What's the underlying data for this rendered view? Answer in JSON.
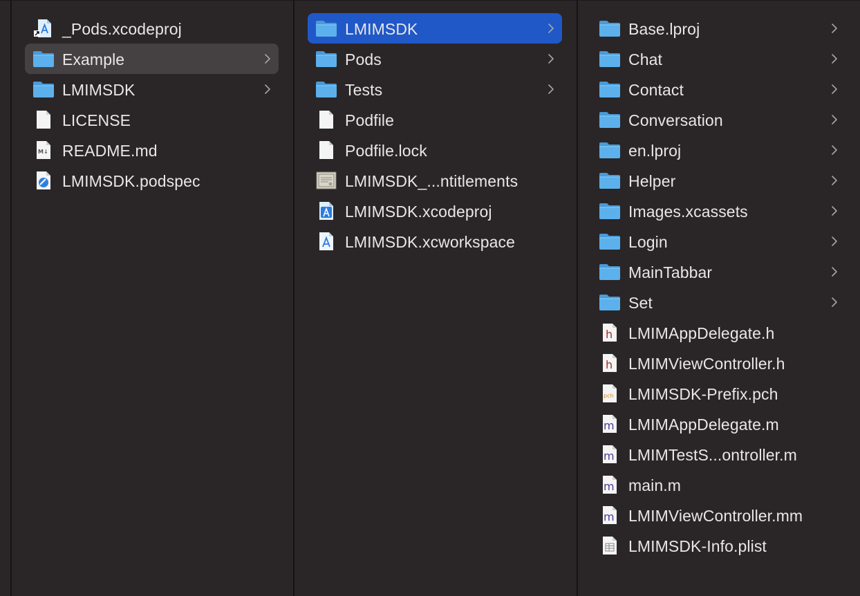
{
  "columns": [
    {
      "name": "column-1",
      "items": [
        {
          "label": "_Pods.xcodeproj",
          "type": "xcodeproj-alias",
          "chevron": false,
          "state": ""
        },
        {
          "label": "Example",
          "type": "folder",
          "chevron": true,
          "state": "inactive"
        },
        {
          "label": "LMIMSDK",
          "type": "folder",
          "chevron": true,
          "state": ""
        },
        {
          "label": "LICENSE",
          "type": "document",
          "chevron": false,
          "state": ""
        },
        {
          "label": "README.md",
          "type": "markdown",
          "chevron": false,
          "state": ""
        },
        {
          "label": "LMIMSDK.podspec",
          "type": "podspec",
          "chevron": false,
          "state": ""
        }
      ]
    },
    {
      "name": "column-2",
      "items": [
        {
          "label": "LMIMSDK",
          "type": "folder",
          "chevron": true,
          "state": "selected"
        },
        {
          "label": "Pods",
          "type": "folder",
          "chevron": true,
          "state": ""
        },
        {
          "label": "Tests",
          "type": "folder",
          "chevron": true,
          "state": ""
        },
        {
          "label": "Podfile",
          "type": "document",
          "chevron": false,
          "state": ""
        },
        {
          "label": "Podfile.lock",
          "type": "document",
          "chevron": false,
          "state": ""
        },
        {
          "label": "LMIMSDK_...ntitlements",
          "type": "certificate",
          "chevron": false,
          "state": ""
        },
        {
          "label": "LMIMSDK.xcodeproj",
          "type": "xcodeproj",
          "chevron": false,
          "state": ""
        },
        {
          "label": "LMIMSDK.xcworkspace",
          "type": "xcworkspace",
          "chevron": false,
          "state": ""
        }
      ]
    },
    {
      "name": "column-3",
      "items": [
        {
          "label": "Base.lproj",
          "type": "folder",
          "chevron": true,
          "state": ""
        },
        {
          "label": "Chat",
          "type": "folder",
          "chevron": true,
          "state": ""
        },
        {
          "label": "Contact",
          "type": "folder",
          "chevron": true,
          "state": ""
        },
        {
          "label": "Conversation",
          "type": "folder",
          "chevron": true,
          "state": ""
        },
        {
          "label": "en.lproj",
          "type": "folder",
          "chevron": true,
          "state": ""
        },
        {
          "label": "Helper",
          "type": "folder",
          "chevron": true,
          "state": ""
        },
        {
          "label": "Images.xcassets",
          "type": "folder",
          "chevron": true,
          "state": ""
        },
        {
          "label": "Login",
          "type": "folder",
          "chevron": true,
          "state": ""
        },
        {
          "label": "MainTabbar",
          "type": "folder",
          "chevron": true,
          "state": ""
        },
        {
          "label": "Set",
          "type": "folder",
          "chevron": true,
          "state": ""
        },
        {
          "label": "LMIMAppDelegate.h",
          "type": "header",
          "chevron": false,
          "state": ""
        },
        {
          "label": "LMIMViewController.h",
          "type": "header",
          "chevron": false,
          "state": ""
        },
        {
          "label": "LMIMSDK-Prefix.pch",
          "type": "pch",
          "chevron": false,
          "state": ""
        },
        {
          "label": "LMIMAppDelegate.m",
          "type": "objc",
          "chevron": false,
          "state": ""
        },
        {
          "label": "LMIMTestS...ontroller.m",
          "type": "objc",
          "chevron": false,
          "state": ""
        },
        {
          "label": "main.m",
          "type": "objc",
          "chevron": false,
          "state": ""
        },
        {
          "label": "LMIMViewController.mm",
          "type": "objcpp",
          "chevron": false,
          "state": ""
        },
        {
          "label": "LMIMSDK-Info.plist",
          "type": "plist",
          "chevron": false,
          "state": ""
        }
      ]
    }
  ],
  "colors": {
    "background": "#2a2627",
    "divider": "#141213",
    "selection": "#2058c8",
    "inactive_selection": "#454143",
    "folder": "#5cb1ec",
    "text": "#e9e6e7"
  }
}
